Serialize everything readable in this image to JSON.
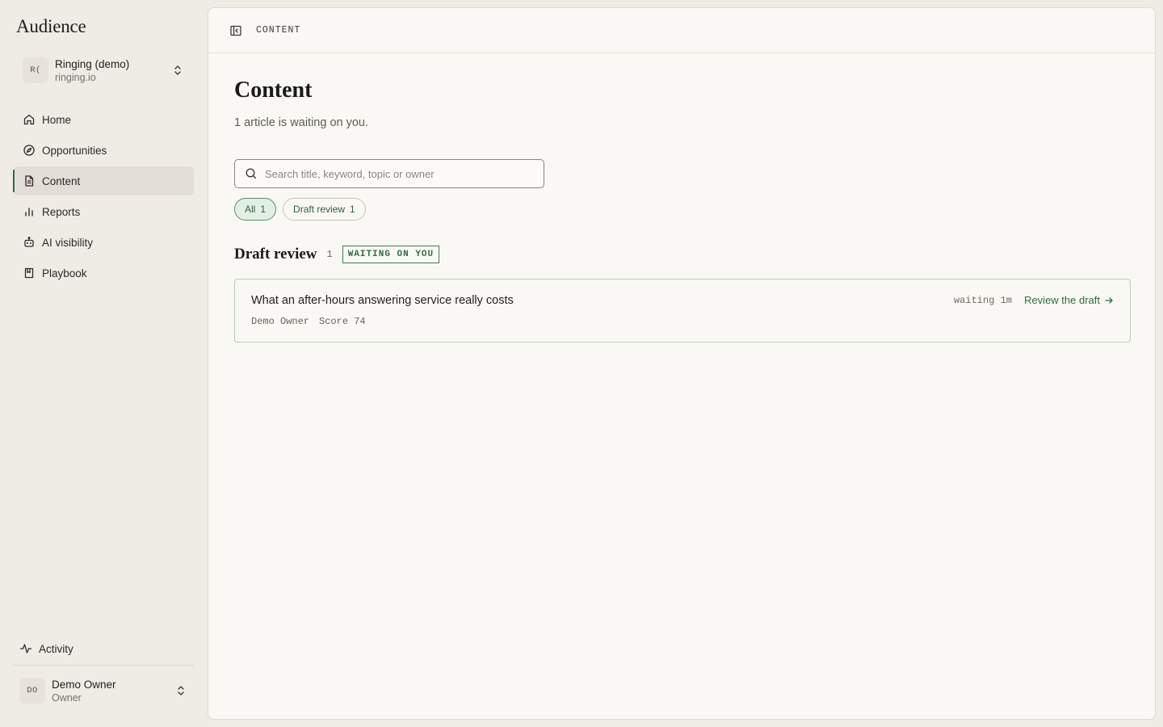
{
  "app": {
    "brand": "Audience"
  },
  "workspace": {
    "avatar": "R(",
    "name": "Ringing (demo)",
    "domain": "ringing.io"
  },
  "nav": {
    "items": [
      {
        "label": "Home",
        "icon": "home-icon"
      },
      {
        "label": "Opportunities",
        "icon": "compass-icon"
      },
      {
        "label": "Content",
        "icon": "document-icon",
        "active": true
      },
      {
        "label": "Reports",
        "icon": "bar-chart-icon"
      },
      {
        "label": "AI visibility",
        "icon": "robot-icon"
      },
      {
        "label": "Playbook",
        "icon": "book-icon"
      }
    ]
  },
  "activity": {
    "label": "Activity",
    "icon": "activity-icon"
  },
  "user": {
    "avatar": "DO",
    "name": "Demo Owner",
    "role": "Owner"
  },
  "header": {
    "breadcrumb": "CONTENT"
  },
  "page": {
    "title": "Content",
    "subtitle": "1 article is waiting on you."
  },
  "search": {
    "placeholder": "Search title, keyword, topic or owner",
    "value": ""
  },
  "filters": [
    {
      "label": "All",
      "count": "1",
      "active": true
    },
    {
      "label": "Draft review",
      "count": "1",
      "active": false
    }
  ],
  "section": {
    "title": "Draft review",
    "count": "1",
    "badge": "WAITING ON YOU"
  },
  "articles": [
    {
      "title": "What an after-hours answering service really costs",
      "owner": "Demo Owner",
      "score": "Score 74",
      "waiting": "waiting 1m",
      "action": "Review the draft"
    }
  ],
  "colors": {
    "accent": "#2f6b45",
    "sidebar_bg": "#efebe5",
    "main_bg": "#faf8f4"
  }
}
